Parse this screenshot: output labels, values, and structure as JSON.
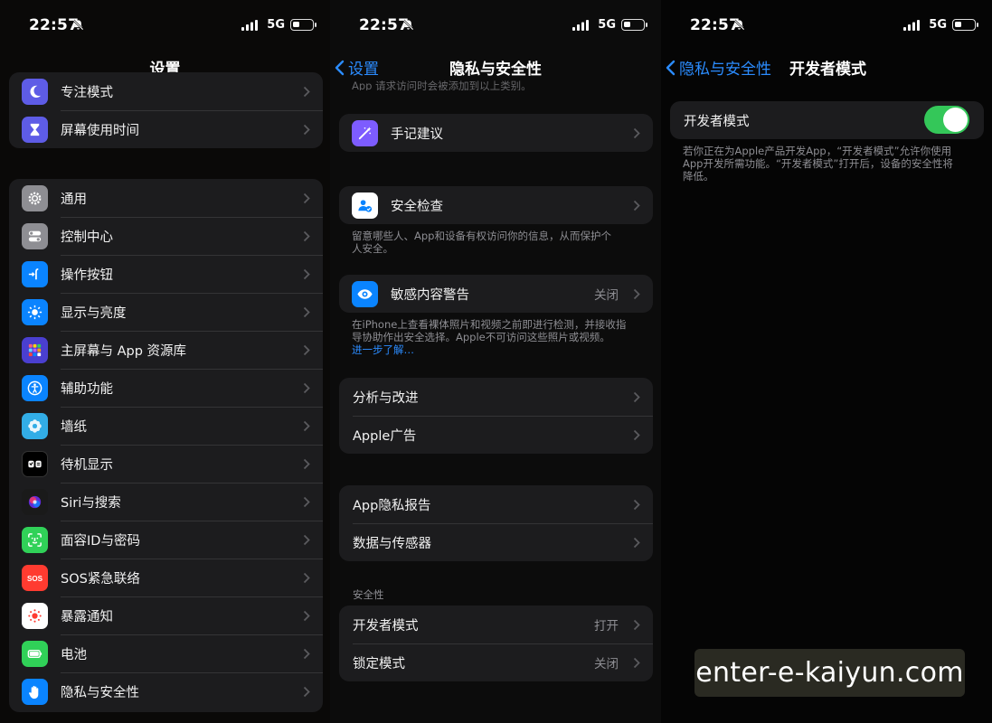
{
  "status_bar": {
    "time": "22:57",
    "network": "5G"
  },
  "panel1": {
    "title": "设置",
    "group_top": [
      {
        "label": "专注模式",
        "icon": "moon-icon",
        "color": "#5e5ce6"
      },
      {
        "label": "屏幕使用时间",
        "icon": "hourglass-icon",
        "color": "#5e5ce6"
      }
    ],
    "group_main": [
      {
        "label": "通用",
        "icon": "gear-icon",
        "color": "#8e8e93"
      },
      {
        "label": "控制中心",
        "icon": "toggles-icon",
        "color": "#8e8e93"
      },
      {
        "label": "操作按钮",
        "icon": "action-button-icon",
        "color": "#0a84ff"
      },
      {
        "label": "显示与亮度",
        "icon": "sun-icon",
        "color": "#0a84ff"
      },
      {
        "label": "主屏幕与 App 资源库",
        "icon": "app-grid-icon",
        "color": "#5e5ce6"
      },
      {
        "label": "辅助功能",
        "icon": "accessibility-icon",
        "color": "#0a84ff"
      },
      {
        "label": "墙纸",
        "icon": "flower-icon",
        "color": "#32ade6"
      },
      {
        "label": "待机显示",
        "icon": "standby-icon",
        "color": "#1c1c1e"
      },
      {
        "label": "Siri与搜索",
        "icon": "siri-icon",
        "color": "#222"
      },
      {
        "label": "面容ID与密码",
        "icon": "face-id-icon",
        "color": "#30d158"
      },
      {
        "label": "SOS紧急联络",
        "icon": "sos-icon",
        "color": "#ff3b30"
      },
      {
        "label": "暴露通知",
        "icon": "exposure-icon",
        "color": "#ffffff"
      },
      {
        "label": "电池",
        "icon": "battery-icon",
        "color": "#30d158"
      },
      {
        "label": "隐私与安全性",
        "icon": "hand-icon",
        "color": "#0a84ff"
      }
    ]
  },
  "panel2": {
    "back_label": "设置",
    "title": "隐私与安全性",
    "top_note": "App 请求访问时会被添加到以上类别。",
    "journal": {
      "label": "手记建议",
      "icon": "journal-icon"
    },
    "safety": {
      "label": "安全检查",
      "icon": "safety-check-icon"
    },
    "safety_note": "留意哪些人、App和设备有权访问你的信息，从而保护个人安全。",
    "sensitive": {
      "label": "敏感内容警告",
      "value": "关闭",
      "icon": "eye-icon"
    },
    "sensitive_note": "在iPhone上查看裸体照片和视频之前即进行检测，并接收指导协助作出安全选择。Apple不可访问这些照片或视频。",
    "sensitive_link": "进一步了解…",
    "analytics": [
      "分析与改进",
      "Apple广告"
    ],
    "reports": [
      "App隐私报告",
      "数据与传感器"
    ],
    "security_header": "安全性",
    "security": [
      {
        "label": "开发者模式",
        "value": "打开"
      },
      {
        "label": "锁定模式",
        "value": "关闭"
      }
    ]
  },
  "panel3": {
    "back_label": "隐私与安全性",
    "title": "开发者模式",
    "toggle_label": "开发者模式",
    "toggle_on": true,
    "note": "若你正在为Apple产品开发App，“开发者模式”允许你使用App开发所需功能。“开发者模式”打开后，设备的安全性将降低。"
  },
  "watermark": "enter-e-kaiyun.com"
}
